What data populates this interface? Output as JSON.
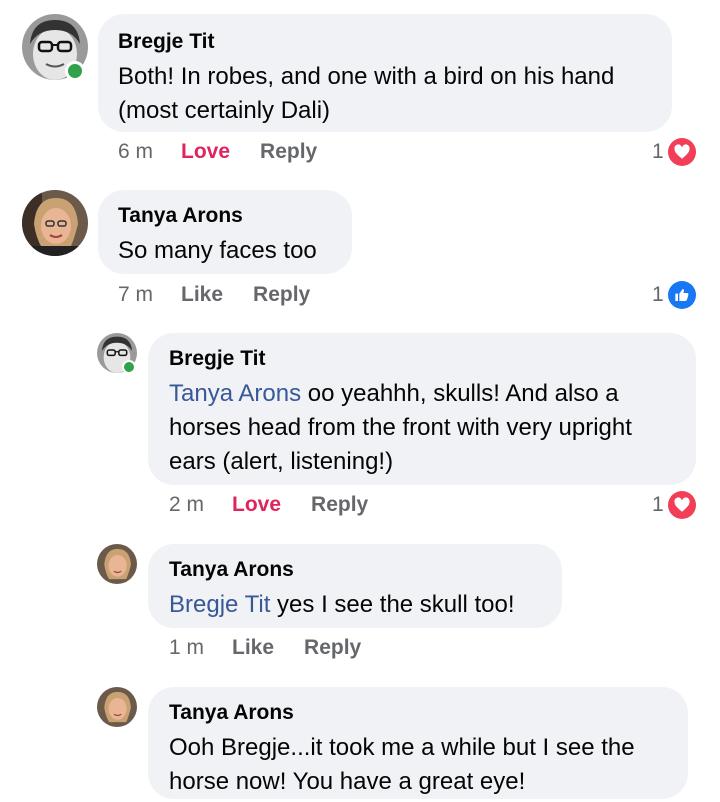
{
  "comments": [
    {
      "author": "Bregje Tit",
      "mention": "",
      "text": "Both! In robes, and one with a bird on his hand (most certainly Dali)",
      "time": "6 m",
      "reaction_action": "Love",
      "reply_label": "Reply",
      "reaction_count": "1",
      "reaction_type": "love"
    },
    {
      "author": "Tanya Arons",
      "mention": "",
      "text": "So many faces too",
      "time": "7 m",
      "reaction_action": "Like",
      "reply_label": "Reply",
      "reaction_count": "1",
      "reaction_type": "like"
    },
    {
      "author": "Bregje Tit",
      "mention": "Tanya Arons",
      "text": " oo yeahhh, skulls! And also a horses head from the front with very upright ears (alert, listening!)",
      "time": "2 m",
      "reaction_action": "Love",
      "reply_label": "Reply",
      "reaction_count": "1",
      "reaction_type": "love"
    },
    {
      "author": "Tanya Arons",
      "mention": "Bregje Tit",
      "text": " yes I see the skull too!",
      "time": "1 m",
      "reaction_action": "Like",
      "reply_label": "Reply",
      "reaction_count": "",
      "reaction_type": ""
    },
    {
      "author": "Tanya Arons",
      "mention": "",
      "text": "Ooh Bregje...it took me a while but I see the horse now!  You have a great eye!",
      "time": "",
      "reaction_action": "",
      "reply_label": "",
      "reaction_count": "",
      "reaction_type": ""
    }
  ],
  "colors": {
    "bubble": "#f0f2f5",
    "mention": "#385898",
    "love": "#f33e58",
    "like": "#1877f2",
    "online": "#31a24c",
    "meta": "#65676b"
  }
}
